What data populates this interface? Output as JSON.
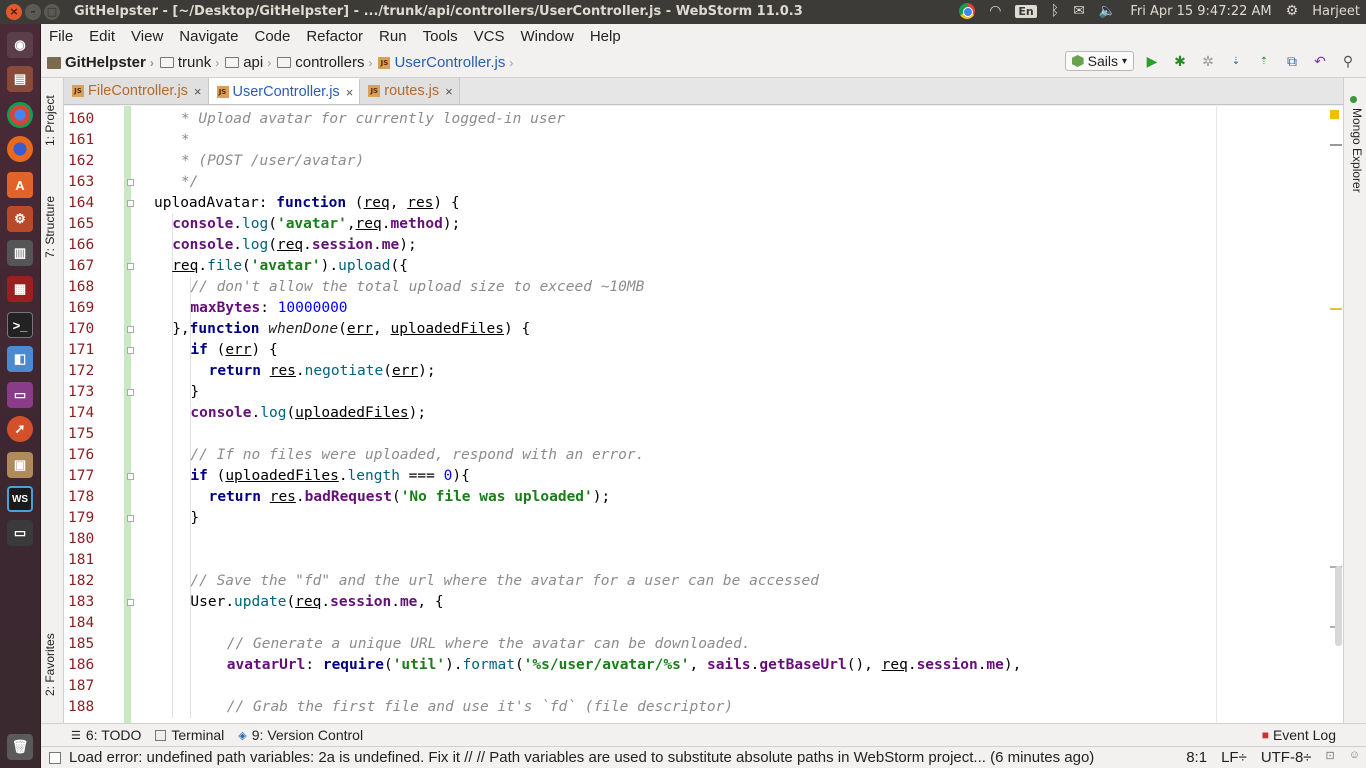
{
  "window": {
    "title": "GitHelpster - [~/Desktop/GitHelpster] - .../trunk/api/controllers/UserController.js - WebStorm 11.0.3"
  },
  "system_tray": {
    "keyboard_layout": "En",
    "datetime": "Fri Apr 15  9:47:22 AM",
    "user": "Harjeet"
  },
  "menu": [
    "File",
    "Edit",
    "View",
    "Navigate",
    "Code",
    "Refactor",
    "Run",
    "Tools",
    "VCS",
    "Window",
    "Help"
  ],
  "breadcrumbs": [
    "GitHelpster",
    "trunk",
    "api",
    "controllers",
    "UserController.js"
  ],
  "run_config": "Sails",
  "left_tool_tabs": [
    "1: Project",
    "7: Structure",
    "2: Favorites"
  ],
  "right_tool_tabs": [
    "Mongo Explorer"
  ],
  "tabs": [
    {
      "label": "FileController.js",
      "active": false
    },
    {
      "label": "UserController.js",
      "active": true
    },
    {
      "label": "routes.js",
      "active": false
    }
  ],
  "code_lines": [
    {
      "n": "160",
      "indent": 1,
      "tokens": [
        [
          "c-com",
          " * Upload avatar for currently logged-in user"
        ]
      ]
    },
    {
      "n": "161",
      "indent": 1,
      "tokens": [
        [
          "c-com",
          " *"
        ]
      ]
    },
    {
      "n": "162",
      "indent": 1,
      "tokens": [
        [
          "c-com",
          " * (POST /user/avatar)"
        ]
      ]
    },
    {
      "n": "163",
      "indent": 1,
      "tokens": [
        [
          "c-com",
          " */"
        ]
      ]
    },
    {
      "n": "164",
      "indent": 0,
      "tokens": [
        [
          "c-plain",
          "uploadAvatar"
        ],
        [
          "c-plain",
          ": "
        ],
        [
          "c-kw",
          "function"
        ],
        [
          "c-plain",
          " ("
        ],
        [
          "c-param",
          "req"
        ],
        [
          "c-plain",
          ", "
        ],
        [
          "c-param",
          "res"
        ],
        [
          "c-plain",
          ") {"
        ]
      ]
    },
    {
      "n": "165",
      "indent": 1,
      "tokens": [
        [
          "c-prop",
          "console"
        ],
        [
          "c-plain",
          "."
        ],
        [
          "c-fn",
          "log"
        ],
        [
          "c-plain",
          "("
        ],
        [
          "c-str",
          "'avatar'"
        ],
        [
          "c-plain",
          ","
        ],
        [
          "c-param",
          "req"
        ],
        [
          "c-plain",
          "."
        ],
        [
          "c-prop",
          "method"
        ],
        [
          "c-plain",
          ");"
        ]
      ]
    },
    {
      "n": "166",
      "indent": 1,
      "tokens": [
        [
          "c-prop",
          "console"
        ],
        [
          "c-plain",
          "."
        ],
        [
          "c-fn",
          "log"
        ],
        [
          "c-plain",
          "("
        ],
        [
          "c-param",
          "req"
        ],
        [
          "c-plain",
          "."
        ],
        [
          "c-prop",
          "session"
        ],
        [
          "c-plain",
          "."
        ],
        [
          "c-prop",
          "me"
        ],
        [
          "c-plain",
          ");"
        ]
      ]
    },
    {
      "n": "167",
      "indent": 1,
      "tokens": [
        [
          "c-param",
          "req"
        ],
        [
          "c-plain",
          "."
        ],
        [
          "c-fn",
          "file"
        ],
        [
          "c-plain",
          "("
        ],
        [
          "c-str",
          "'avatar'"
        ],
        [
          "c-plain",
          ")."
        ],
        [
          "c-fn",
          "upload"
        ],
        [
          "c-plain",
          "({"
        ]
      ]
    },
    {
      "n": "168",
      "indent": 2,
      "tokens": [
        [
          "c-com",
          "// don't allow the total upload size to exceed ~10MB"
        ]
      ]
    },
    {
      "n": "169",
      "indent": 2,
      "tokens": [
        [
          "c-prop",
          "maxBytes"
        ],
        [
          "c-plain",
          ": "
        ],
        [
          "c-num",
          "10000000"
        ]
      ]
    },
    {
      "n": "170",
      "indent": 1,
      "tokens": [
        [
          "c-plain",
          "},"
        ],
        [
          "c-kw",
          "function"
        ],
        [
          "c-plain",
          " "
        ],
        [
          "c-it",
          "whenDone"
        ],
        [
          "c-plain",
          "("
        ],
        [
          "c-param",
          "err"
        ],
        [
          "c-plain",
          ", "
        ],
        [
          "c-param",
          "uploadedFiles"
        ],
        [
          "c-plain",
          ") {"
        ]
      ]
    },
    {
      "n": "171",
      "indent": 2,
      "tokens": [
        [
          "c-kw",
          "if"
        ],
        [
          "c-plain",
          " ("
        ],
        [
          "c-param",
          "err"
        ],
        [
          "c-plain",
          ") {"
        ]
      ]
    },
    {
      "n": "172",
      "indent": 3,
      "tokens": [
        [
          "c-kw",
          "return"
        ],
        [
          "c-plain",
          " "
        ],
        [
          "c-param",
          "res"
        ],
        [
          "c-plain",
          "."
        ],
        [
          "c-fn",
          "negotiate"
        ],
        [
          "c-plain",
          "("
        ],
        [
          "c-param",
          "err"
        ],
        [
          "c-plain",
          ");"
        ]
      ]
    },
    {
      "n": "173",
      "indent": 2,
      "tokens": [
        [
          "c-plain",
          "}"
        ]
      ]
    },
    {
      "n": "174",
      "indent": 2,
      "tokens": [
        [
          "c-prop",
          "console"
        ],
        [
          "c-plain",
          "."
        ],
        [
          "c-fn",
          "log"
        ],
        [
          "c-plain",
          "("
        ],
        [
          "c-param",
          "uploadedFiles"
        ],
        [
          "c-plain",
          ");"
        ]
      ]
    },
    {
      "n": "175",
      "indent": 2,
      "tokens": []
    },
    {
      "n": "176",
      "indent": 2,
      "tokens": [
        [
          "c-com",
          "// If no files were uploaded, respond with an error."
        ]
      ]
    },
    {
      "n": "177",
      "indent": 2,
      "tokens": [
        [
          "c-kw",
          "if"
        ],
        [
          "c-plain",
          " ("
        ],
        [
          "c-param",
          "uploadedFiles"
        ],
        [
          "c-plain",
          "."
        ],
        [
          "c-fn",
          "length"
        ],
        [
          "c-plain",
          " === "
        ],
        [
          "c-num",
          "0"
        ],
        [
          "c-plain",
          "){"
        ]
      ]
    },
    {
      "n": "178",
      "indent": 3,
      "tokens": [
        [
          "c-kw",
          "return"
        ],
        [
          "c-plain",
          " "
        ],
        [
          "c-param",
          "res"
        ],
        [
          "c-plain",
          "."
        ],
        [
          "c-prop",
          "badRequest"
        ],
        [
          "c-plain",
          "("
        ],
        [
          "c-str",
          "'No file was uploaded'"
        ],
        [
          "c-plain",
          ");"
        ]
      ]
    },
    {
      "n": "179",
      "indent": 2,
      "tokens": [
        [
          "c-plain",
          "}"
        ]
      ]
    },
    {
      "n": "180",
      "indent": 2,
      "tokens": []
    },
    {
      "n": "181",
      "indent": 2,
      "tokens": []
    },
    {
      "n": "182",
      "indent": 2,
      "tokens": [
        [
          "c-com",
          "// Save the \"fd\" and the url where the avatar for a user can be accessed"
        ]
      ]
    },
    {
      "n": "183",
      "indent": 2,
      "tokens": [
        [
          "c-plain",
          "User"
        ],
        [
          "c-plain",
          "."
        ],
        [
          "c-fn",
          "update"
        ],
        [
          "c-plain",
          "("
        ],
        [
          "c-param",
          "req"
        ],
        [
          "c-plain",
          "."
        ],
        [
          "c-prop",
          "session"
        ],
        [
          "c-plain",
          "."
        ],
        [
          "c-prop",
          "me"
        ],
        [
          "c-plain",
          ", {"
        ]
      ]
    },
    {
      "n": "184",
      "indent": 2,
      "tokens": []
    },
    {
      "n": "185",
      "indent": 4,
      "tokens": [
        [
          "c-com",
          "// Generate a unique URL where the avatar can be downloaded."
        ]
      ]
    },
    {
      "n": "186",
      "indent": 4,
      "tokens": [
        [
          "c-prop",
          "avatarUrl"
        ],
        [
          "c-plain",
          ": "
        ],
        [
          "c-kw",
          "require"
        ],
        [
          "c-plain",
          "("
        ],
        [
          "c-str",
          "'util'"
        ],
        [
          "c-plain",
          ")."
        ],
        [
          "c-fn",
          "format"
        ],
        [
          "c-plain",
          "("
        ],
        [
          "c-str",
          "'%s/user/avatar/%s'"
        ],
        [
          "c-plain",
          ", "
        ],
        [
          "c-prop",
          "sails"
        ],
        [
          "c-plain",
          "."
        ],
        [
          "c-prop",
          "getBaseUrl"
        ],
        [
          "c-plain",
          "(), "
        ],
        [
          "c-param",
          "req"
        ],
        [
          "c-plain",
          "."
        ],
        [
          "c-prop",
          "session"
        ],
        [
          "c-plain",
          "."
        ],
        [
          "c-prop",
          "me"
        ],
        [
          "c-plain",
          "),"
        ]
      ]
    },
    {
      "n": "187",
      "indent": 4,
      "tokens": []
    },
    {
      "n": "188",
      "indent": 4,
      "tokens": [
        [
          "c-com",
          "// Grab the first file and use it's `fd` (file descriptor)"
        ]
      ]
    }
  ],
  "tool_tabs": [
    "6: TODO",
    "Terminal",
    "9: Version Control"
  ],
  "event_log": "Event Log",
  "status": {
    "message": "Load error: undefined path variables: 2a is undefined. Fix it // // Path variables are used to substitute absolute paths in WebStorm project... (6 minutes ago)",
    "position": "8:1",
    "line_sep": "LF÷",
    "encoding": "UTF-8÷"
  }
}
